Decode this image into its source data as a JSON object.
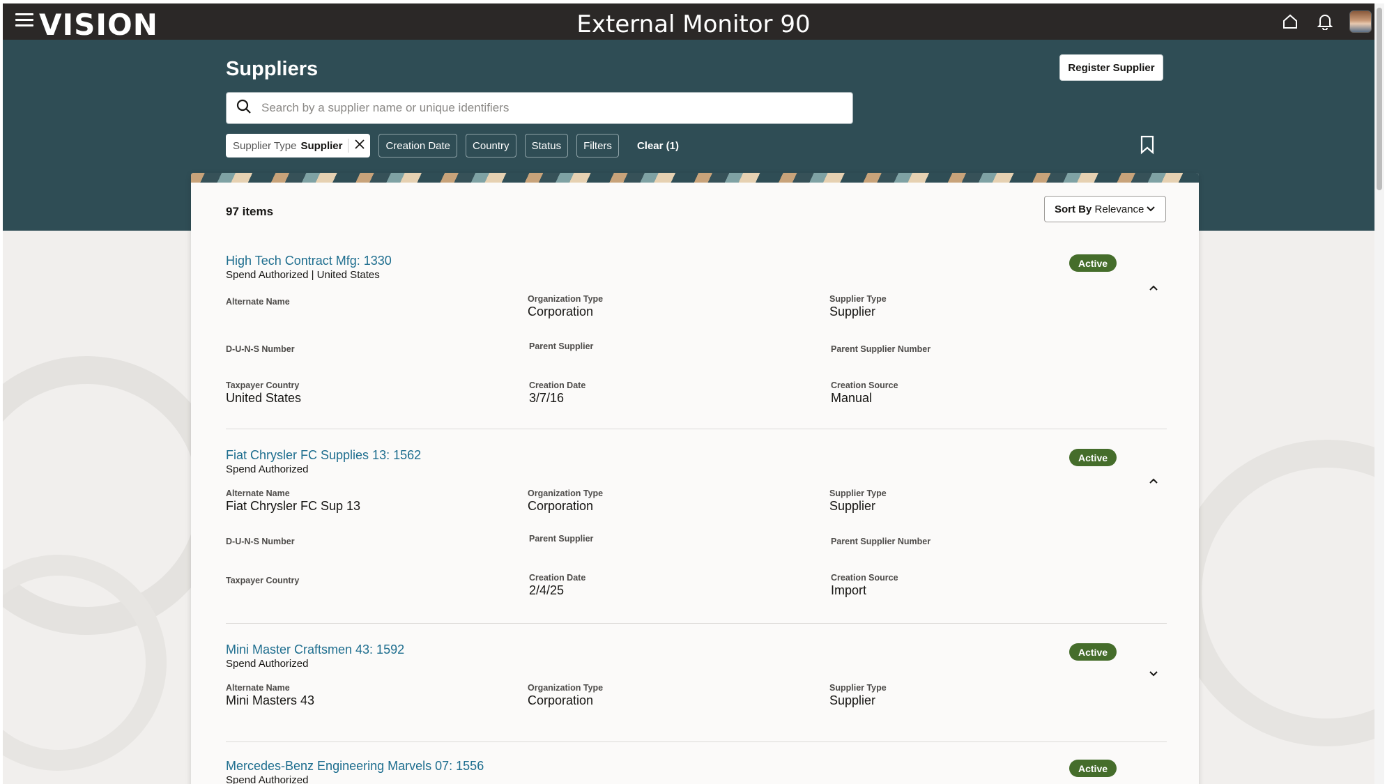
{
  "app": {
    "logo": "VISION",
    "title": "External Monitor 90"
  },
  "icons": {
    "menu": "hamburger-menu-icon",
    "home": "home-icon",
    "notifications": "bell-icon",
    "avatar": "user-avatar",
    "search": "search-icon",
    "remove_filter": "close-icon",
    "bookmark": "bookmark-icon",
    "sort_chevron": "chevron-down-icon",
    "collapse": "chevron-up-icon",
    "expand": "chevron-down-icon"
  },
  "header": {
    "page_title": "Suppliers",
    "register_label": "Register Supplier",
    "search_placeholder": "Search by a supplier name or unique identifiers",
    "filter_active": {
      "label": "Supplier Type",
      "value": "Supplier"
    },
    "filter_chips": [
      "Creation Date",
      "Country",
      "Status",
      "Filters"
    ],
    "clear_label": "Clear (1)"
  },
  "results": {
    "count_label": "97 items",
    "sort_prefix": "Sort By",
    "sort_value": "Relevance",
    "records": [
      {
        "name": "High Tech Contract Mfg: 1330",
        "sub": "Spend Authorized | United States",
        "status": "Active",
        "expanded": true,
        "fields": {
          "alternate_name": {
            "label": "Alternate Name",
            "value": ""
          },
          "organization_type": {
            "label": "Organization Type",
            "value": "Corporation"
          },
          "supplier_type": {
            "label": "Supplier Type",
            "value": "Supplier"
          },
          "duns": {
            "label": "D-U-N-S Number",
            "value": ""
          },
          "parent_supplier": {
            "label": "Parent Supplier",
            "value": ""
          },
          "parent_supplier_number": {
            "label": "Parent Supplier Number",
            "value": ""
          },
          "taxpayer_country": {
            "label": "Taxpayer Country",
            "value": "United States"
          },
          "creation_date": {
            "label": "Creation Date",
            "value": "3/7/16"
          },
          "creation_source": {
            "label": "Creation Source",
            "value": "Manual"
          }
        }
      },
      {
        "name": "Fiat Chrysler FC Supplies 13: 1562",
        "sub": "Spend Authorized",
        "status": "Active",
        "expanded": true,
        "fields": {
          "alternate_name": {
            "label": "Alternate Name",
            "value": "Fiat Chrysler FC Sup 13"
          },
          "organization_type": {
            "label": "Organization Type",
            "value": "Corporation"
          },
          "supplier_type": {
            "label": "Supplier Type",
            "value": "Supplier"
          },
          "duns": {
            "label": "D-U-N-S Number",
            "value": ""
          },
          "parent_supplier": {
            "label": "Parent Supplier",
            "value": ""
          },
          "parent_supplier_number": {
            "label": "Parent Supplier Number",
            "value": ""
          },
          "taxpayer_country": {
            "label": "Taxpayer Country",
            "value": ""
          },
          "creation_date": {
            "label": "Creation Date",
            "value": "2/4/25"
          },
          "creation_source": {
            "label": "Creation Source",
            "value": "Import"
          }
        }
      },
      {
        "name": "Mini Master Craftsmen 43: 1592",
        "sub": "Spend Authorized",
        "status": "Active",
        "expanded": false,
        "fields": {
          "alternate_name": {
            "label": "Alternate Name",
            "value": "Mini Masters 43"
          },
          "organization_type": {
            "label": "Organization Type",
            "value": "Corporation"
          },
          "supplier_type": {
            "label": "Supplier Type",
            "value": "Supplier"
          }
        }
      },
      {
        "name": "Mercedes-Benz Engineering Marvels 07: 1556",
        "sub": "Spend Authorized",
        "status": "Active",
        "expanded": false
      }
    ]
  },
  "colors": {
    "topbar": "#2b2827",
    "header_band": "#2f4d55",
    "link": "#1d6d8e",
    "active_badge": "#456d2b"
  }
}
